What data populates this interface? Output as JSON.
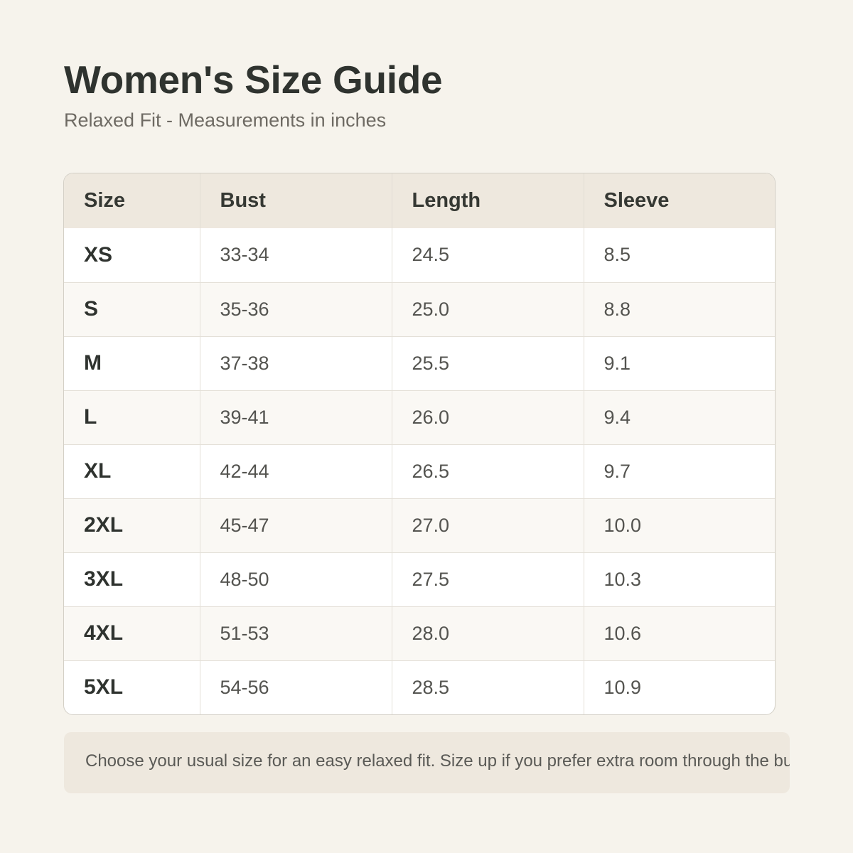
{
  "header": {
    "title": "Women's Size Guide",
    "subtitle": "Relaxed Fit - Measurements in inches"
  },
  "table": {
    "columns": [
      "Size",
      "Bust",
      "Length",
      "Sleeve"
    ],
    "rows": [
      {
        "size": "XS",
        "bust": "33-34",
        "length": "24.5",
        "sleeve": "8.5"
      },
      {
        "size": "S",
        "bust": "35-36",
        "length": "25.0",
        "sleeve": "8.8"
      },
      {
        "size": "M",
        "bust": "37-38",
        "length": "25.5",
        "sleeve": "9.1"
      },
      {
        "size": "L",
        "bust": "39-41",
        "length": "26.0",
        "sleeve": "9.4"
      },
      {
        "size": "XL",
        "bust": "42-44",
        "length": "26.5",
        "sleeve": "9.7"
      },
      {
        "size": "2XL",
        "bust": "45-47",
        "length": "27.0",
        "sleeve": "10.0"
      },
      {
        "size": "3XL",
        "bust": "48-50",
        "length": "27.5",
        "sleeve": "10.3"
      },
      {
        "size": "4XL",
        "bust": "51-53",
        "length": "28.0",
        "sleeve": "10.6"
      },
      {
        "size": "5XL",
        "bust": "54-56",
        "length": "28.5",
        "sleeve": "10.9"
      }
    ]
  },
  "note": {
    "text": "Choose your usual size for an easy relaxed fit. Size up if you prefer extra room through the bust and ar"
  },
  "colors": {
    "background": "#f6f3ec",
    "header_row": "#eee8de",
    "title_text": "#2f332f"
  }
}
